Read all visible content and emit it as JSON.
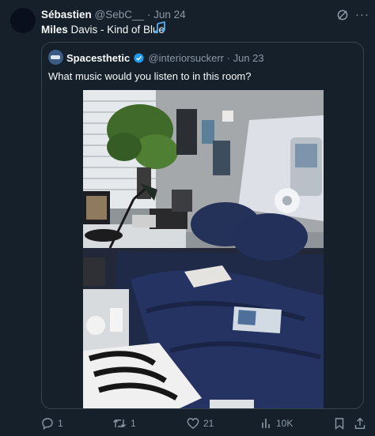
{
  "post": {
    "author_name": "Sébastien",
    "handle": "@SebC__",
    "separator": "·",
    "date": "Jun 24",
    "text_bold": "Miles",
    "text_rest": " Davis - Kind of Blue",
    "emoji_icon": "musical-notes-icon"
  },
  "quote": {
    "author_name": "Spacesthetic",
    "handle": "@interiorsuckerr",
    "separator": "·",
    "date": "Jun 23",
    "text": "What music would you listen to in this room?"
  },
  "actions": {
    "replies": "1",
    "reposts": "1",
    "likes": "21",
    "views": "10K"
  },
  "colors": {
    "background": "#15202b",
    "text": "#f7f9f9",
    "muted": "#8b98a5",
    "accent": "#1d9bf0",
    "border": "#38444d"
  }
}
